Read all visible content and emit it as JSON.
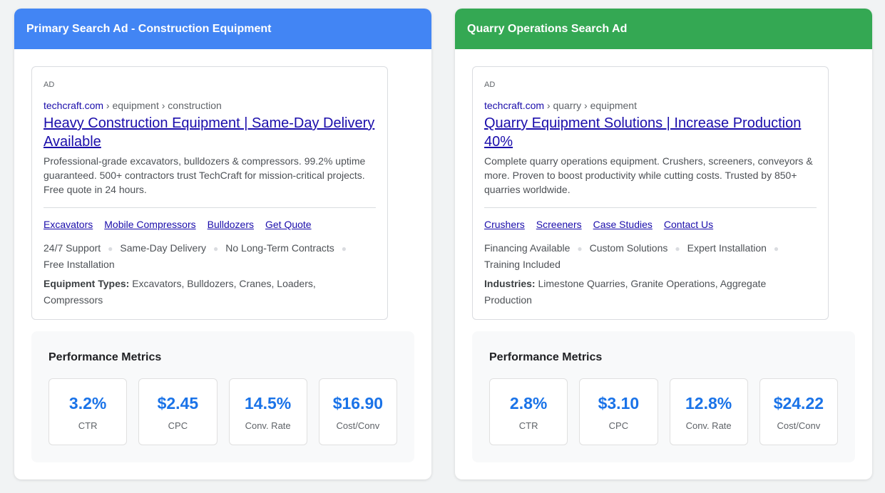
{
  "ads": [
    {
      "header": "Primary Search Ad - Construction Equipment",
      "ad_label": "AD",
      "domain": "techcraft.com",
      "path": " › equipment › construction",
      "headline": "Heavy Construction Equipment | Same-Day Delivery Available",
      "description": "Professional-grade excavators, bulldozers & compressors. 99.2% uptime guaranteed. 500+ contractors trust TechCraft for mission-critical projects. Free quote in 24 hours.",
      "sitelinks": [
        "Excavators",
        "Mobile Compressors",
        "Bulldozers",
        "Get Quote"
      ],
      "callouts": [
        "24/7 Support",
        "Same-Day Delivery",
        "No Long-Term Contracts",
        "Free Installation"
      ],
      "snippet_label": "Equipment Types:",
      "snippet_values": " Excavators, Bulldozers, Cranes, Loaders, Compressors",
      "metrics_title": "Performance Metrics",
      "metrics": [
        {
          "value": "3.2%",
          "label": "CTR"
        },
        {
          "value": "$2.45",
          "label": "CPC"
        },
        {
          "value": "14.5%",
          "label": "Conv. Rate"
        },
        {
          "value": "$16.90",
          "label": "Cost/Conv"
        }
      ]
    },
    {
      "header": "Quarry Operations Search Ad",
      "ad_label": "AD",
      "domain": "techcraft.com",
      "path": " › quarry › equipment",
      "headline": "Quarry Equipment Solutions | Increase Production 40%",
      "description": "Complete quarry operations equipment. Crushers, screeners, conveyors & more. Proven to boost productivity while cutting costs. Trusted by 850+ quarries worldwide.",
      "sitelinks": [
        "Crushers",
        "Screeners",
        "Case Studies",
        "Contact Us"
      ],
      "callouts": [
        "Financing Available",
        "Custom Solutions",
        "Expert Installation",
        "Training Included"
      ],
      "snippet_label": "Industries:",
      "snippet_values": " Limestone Quarries, Granite Operations, Aggregate Production",
      "metrics_title": "Performance Metrics",
      "metrics": [
        {
          "value": "2.8%",
          "label": "CTR"
        },
        {
          "value": "$3.10",
          "label": "CPC"
        },
        {
          "value": "12.8%",
          "label": "Conv. Rate"
        },
        {
          "value": "$24.22",
          "label": "Cost/Conv"
        }
      ]
    }
  ],
  "colors": {
    "left_header": "#4285f4",
    "right_header": "#34a853",
    "link": "#1a0dab",
    "metric_value": "#1a73e8"
  }
}
